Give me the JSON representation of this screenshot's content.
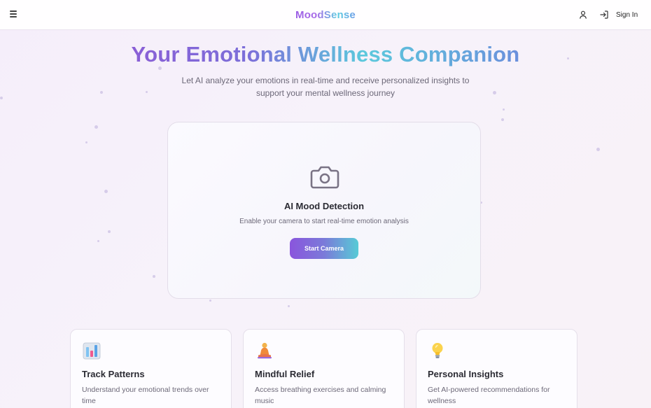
{
  "header": {
    "brand": "MoodSense",
    "signin_label": "Sign In",
    "icons": {
      "menu": "menu-icon",
      "user": "user-icon",
      "signin": "sign-in-icon"
    }
  },
  "hero": {
    "title": "Your Emotional Wellness Companion",
    "subtitle_line1": "Let AI analyze your emotions in real-time and receive personalized insights to",
    "subtitle_line2": "support your mental wellness journey"
  },
  "camera_card": {
    "icon": "camera-icon",
    "title": "AI Mood Detection",
    "description": "Enable your camera to start real-time emotion analysis",
    "button_label": "Start Camera"
  },
  "features": [
    {
      "icon": "bar-chart-icon",
      "title": "Track Patterns",
      "desc_line1": "Understand your emotional trends over",
      "desc_line2": "time"
    },
    {
      "icon": "meditation-icon",
      "title": "Mindful Relief",
      "desc_line1": "Access breathing exercises and calming",
      "desc_line2": "music"
    },
    {
      "icon": "light-bulb-icon",
      "title": "Personal Insights",
      "desc_line1": "Get AI-powered recommendations for",
      "desc_line2": "wellness"
    }
  ],
  "colors": {
    "accent_purple": "#8a55dd",
    "accent_teal": "#57cbd6",
    "background": "#f6f0fa"
  }
}
